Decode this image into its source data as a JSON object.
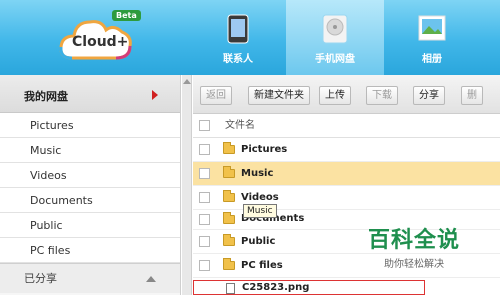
{
  "header": {
    "logo_text": "Cloud+",
    "beta": "Beta",
    "nav": [
      {
        "label": "联系人",
        "icon": "phone-icon"
      },
      {
        "label": "手机网盘",
        "icon": "disk-icon"
      },
      {
        "label": "相册",
        "icon": "photo-album-icon"
      }
    ],
    "accent": "#41b7e9"
  },
  "sidebar": {
    "title": "我的网盘",
    "items": [
      "Pictures",
      "Music",
      "Videos",
      "Documents",
      "Public",
      "PC files"
    ],
    "shared": "已分享"
  },
  "toolbar": {
    "back": "返回",
    "new_folder": "新建文件夹",
    "upload": "上传",
    "download": "下载",
    "share": "分享",
    "delete": "删"
  },
  "files": {
    "header": "文件名",
    "rows": [
      "Pictures",
      "Music",
      "Videos",
      "Documents",
      "Public",
      "PC files"
    ],
    "partial": "C25823.png",
    "tooltip": "Music",
    "selected_color": "#fbe2a2"
  },
  "watermark": {
    "title": "百科全说",
    "subtitle": "助你轻松解决"
  }
}
